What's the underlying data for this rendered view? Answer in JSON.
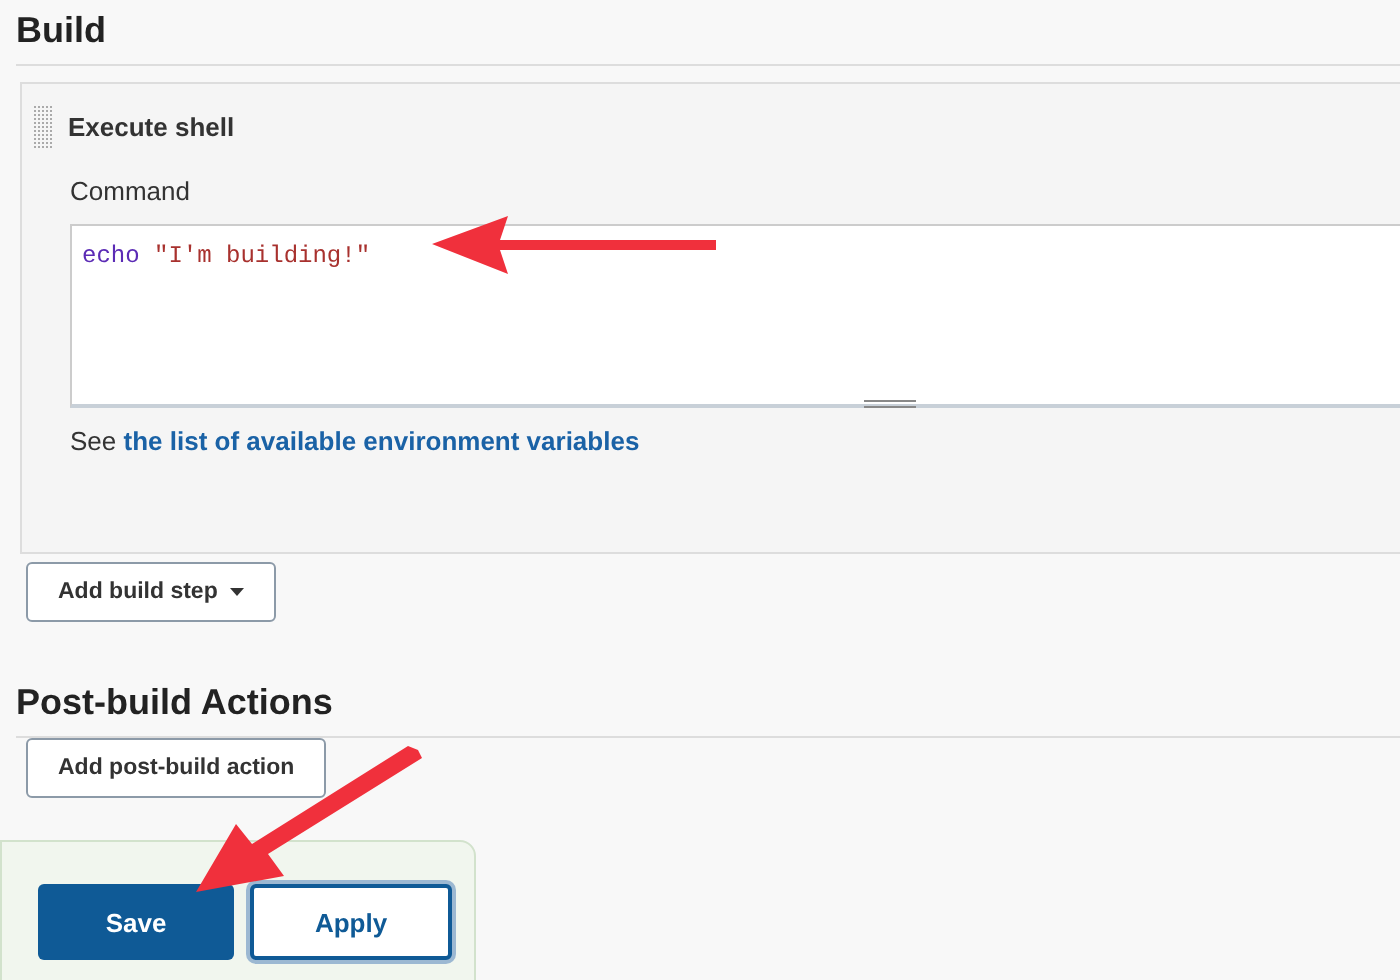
{
  "build": {
    "title": "Build",
    "step": {
      "title": "Execute shell",
      "command_label": "Command",
      "command_tokens": [
        {
          "kind": "keyword",
          "text": "echo"
        },
        {
          "kind": "string",
          "text": "\"I'm building!\""
        }
      ],
      "help_prefix": "See",
      "help_link": "the list of available environment variables"
    },
    "add_button": {
      "label": "Add build step",
      "dropdown": true
    }
  },
  "post_build": {
    "title": "Post-build Actions",
    "add_button": {
      "label": "Add post-build action",
      "dropdown": false
    }
  },
  "actions": [
    {
      "label": "Save",
      "kind": "primary"
    },
    {
      "label": "Apply",
      "kind": "secondary"
    }
  ]
}
